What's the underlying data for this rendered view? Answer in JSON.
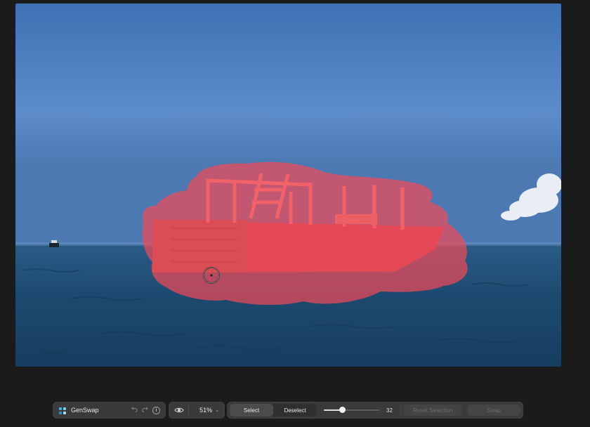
{
  "app": {
    "name": "GenSwap",
    "icon": "genswap-app-icon"
  },
  "history": {
    "undo_icon": "undo-icon",
    "redo_icon": "redo-icon",
    "info_icon": "info-icon",
    "info_glyph": "i"
  },
  "view": {
    "preview_icon": "eye-icon",
    "zoom_label": "51%",
    "zoom_chevron": "⌄"
  },
  "selection": {
    "select_label": "Select",
    "deselect_label": "Deselect",
    "brush_size": "32",
    "brush_fraction": 0.32,
    "reset_label": "Reset Selection",
    "swap_label": "Swap"
  },
  "colors": {
    "sky": "#4e80c0",
    "sea": "#1f4a6c",
    "mask": "#ee4a58",
    "toolbar_bg": "#3a3a3c",
    "app_bg": "#1b1b1c"
  }
}
